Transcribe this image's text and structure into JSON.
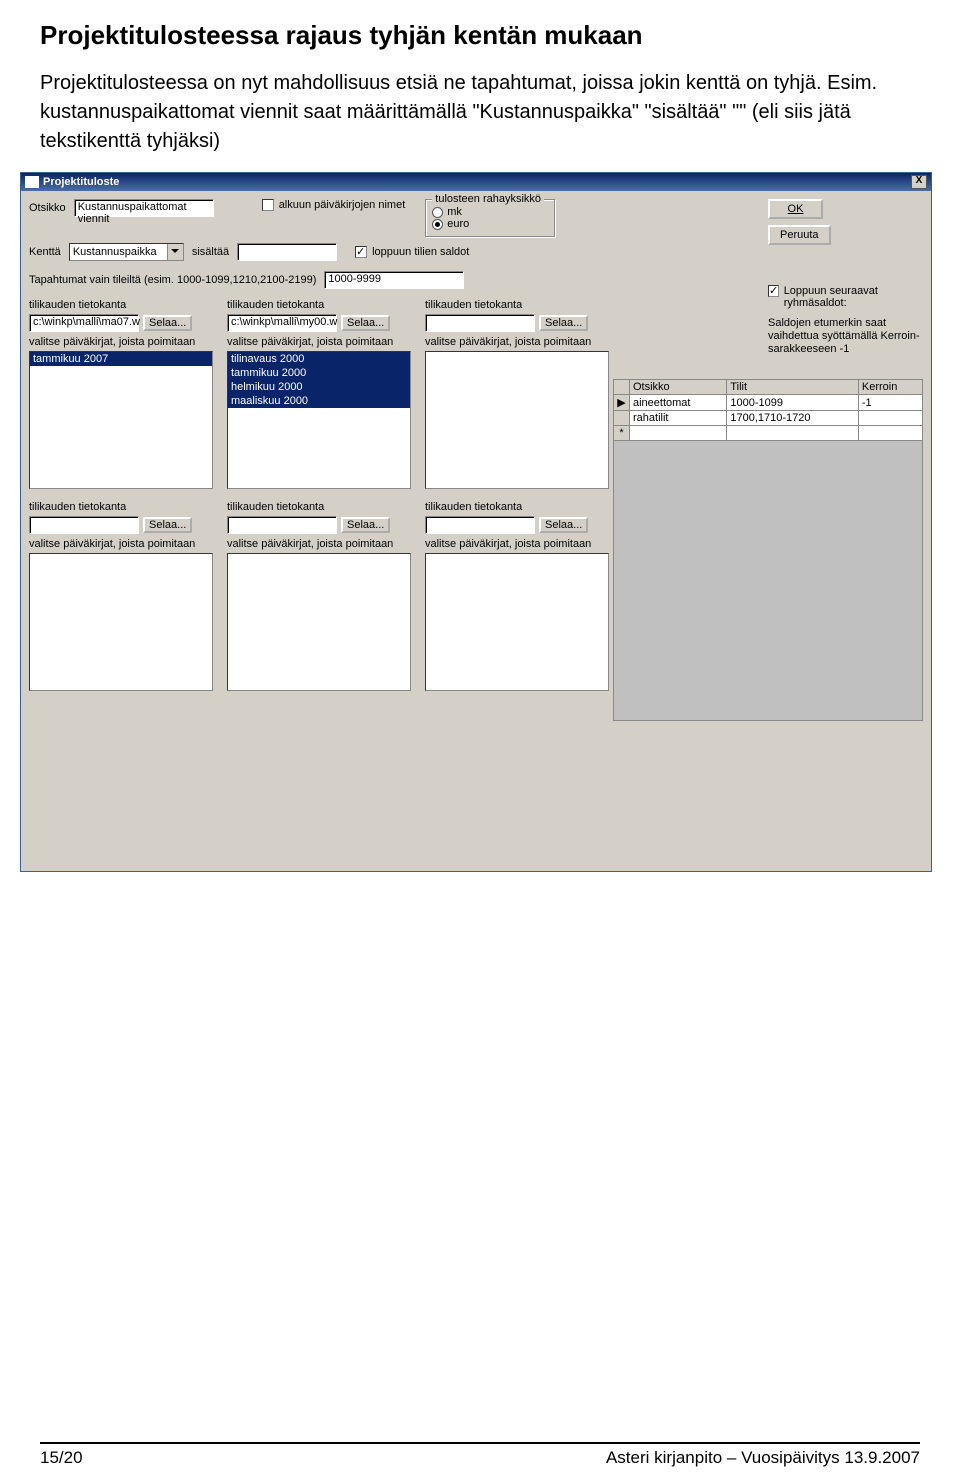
{
  "doc": {
    "heading": "Projektitulosteessa rajaus tyhjän kentän mukaan",
    "body": "Projektitulosteessa on nyt mahdollisuus etsiä ne tapahtumat, joissa jokin kenttä on tyhjä. Esim. kustannuspaikattomat viennit saat määrittämällä \"Kustannuspaikka\" \"sisältää\" \"\" (eli siis jätä tekstikenttä tyhjäksi)"
  },
  "window": {
    "title": "Projektituloste",
    "close": "X"
  },
  "form": {
    "otsikko_label": "Otsikko",
    "otsikko_value": "Kustannuspaikattomat viennit",
    "alkuun_label": "alkuun päiväkirjojen nimet",
    "kentta_label": "Kenttä",
    "kentta_value": "Kustannuspaikka",
    "sisaltaa_label": "sisältää",
    "sisaltaa_value": "",
    "loppuun_label": "loppuun tilien saldot",
    "tapahtumat_label": "Tapahtumat vain tileiltä (esim. 1000-1099,1210,2100-2199)",
    "tapahtumat_value": "1000-9999",
    "rahayksikko_label": "tulosteen rahayksikkö",
    "rahayksikko_mk": "mk",
    "rahayksikko_euro": "euro",
    "ok": "OK",
    "peruuta": "Peruuta",
    "ryhmasaldot_label": "Loppuun seuraavat ryhmäsaldot:",
    "saldojen_tip": "Saldojen etumerkin saat vaihdettua syöttämällä Kerroin-sarakkeeseen -1"
  },
  "db": {
    "label": "tilikauden tietokanta",
    "selaa": "Selaa...",
    "valitse": "valitse päiväkirjat, joista poimitaan",
    "path1": "c:\\winkp\\malli\\ma07.w",
    "path2": "c:\\winkp\\malli\\my00.w",
    "path3": "",
    "list1": [
      "tammikuu 2007"
    ],
    "list2": [
      "tilinavaus 2000",
      "tammikuu 2000",
      "helmikuu 2000",
      "maaliskuu 2000"
    ]
  },
  "grid": {
    "col1": "Otsikko",
    "col2": "Tilit",
    "col3": "Kerroin",
    "rows": [
      {
        "otsikko": "aineettomat",
        "tilit": "1000-1099",
        "kerroin": "-1"
      },
      {
        "otsikko": "rahatilit",
        "tilit": "1700,1710-1720",
        "kerroin": ""
      }
    ]
  },
  "footer": {
    "left": "15/20",
    "right": "Asteri kirjanpito – Vuosipäivitys 13.9.2007"
  }
}
